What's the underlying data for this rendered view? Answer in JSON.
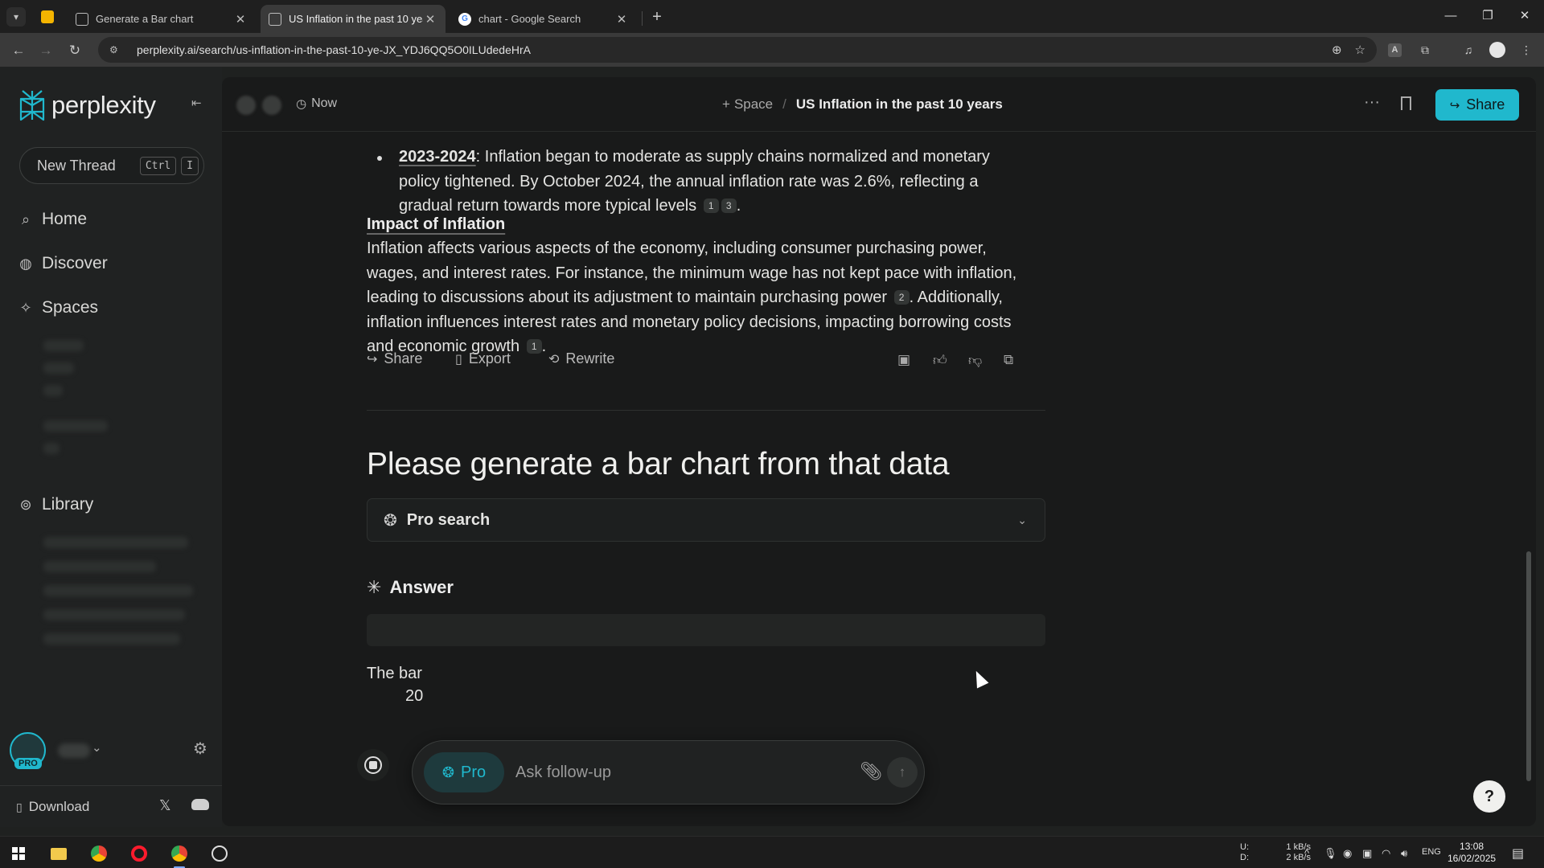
{
  "browser": {
    "tabs": [
      {
        "title": "Generate a Bar chart",
        "active": false
      },
      {
        "title": "US Inflation in the past 10 years",
        "active": true
      },
      {
        "title": "chart - Google Search",
        "active": false
      }
    ],
    "url": "perplexity.ai/search/us-inflation-in-the-past-10-ye-JX_YDJ6QQ5O0ILUdedeHrA"
  },
  "sidebar": {
    "logo_text": "perplexity",
    "new_thread": {
      "label": "New Thread",
      "kbd_ctrl": "Ctrl",
      "kbd_key": "I"
    },
    "items": [
      {
        "label": "Home",
        "icon": "search-icon"
      },
      {
        "label": "Discover",
        "icon": "globe-icon"
      },
      {
        "label": "Spaces",
        "icon": "sparkle-icon"
      },
      {
        "label": "Library",
        "icon": "library-icon"
      }
    ],
    "pro_badge": "PRO",
    "download_label": "Download"
  },
  "header": {
    "time": "Now",
    "space_label": "Space",
    "thread_title": "US Inflation in the past 10 years",
    "share_label": "Share"
  },
  "content": {
    "bullet": {
      "term": "2023-2024",
      "text": ": Inflation began to moderate as supply chains normalized and monetary policy tightened. By October 2024, the annual inflation rate was 2.6%, reflecting a gradual return towards more typical levels",
      "cites": [
        "1",
        "3"
      ]
    },
    "section_title": "Impact of Inflation",
    "paragraph": {
      "part1": "Inflation affects various aspects of the economy, including consumer purchasing power, wages, and interest rates. For instance, the minimum wage has not kept pace with inflation, leading to discussions about its adjustment to maintain purchasing power",
      "cite1": "2",
      "part2": ". Additionally, inflation influences interest rates and monetary policy decisions, impacting borrowing costs and economic growth",
      "cite2": "1",
      "part3": "."
    },
    "actions": {
      "share": "Share",
      "export": "Export",
      "rewrite": "Rewrite"
    },
    "question": "Please generate a bar chart from that data",
    "pro_search_label": "Pro search",
    "answer_label": "Answer",
    "partial_line1": "The bar",
    "partial_line2": "20"
  },
  "followup": {
    "pro_label": "Pro",
    "placeholder": "Ask follow-up"
  },
  "help_label": "?",
  "taskbar": {
    "net_up_label": "U:",
    "net_down_label": "D:",
    "net_up": "1 kB/s",
    "net_down": "2 kB/s",
    "lang": "ENG",
    "time": "13:08",
    "date": "16/02/2025"
  },
  "colors": {
    "accent": "#20b8cd",
    "background": "#191a1a",
    "sidebar": "#202222"
  }
}
